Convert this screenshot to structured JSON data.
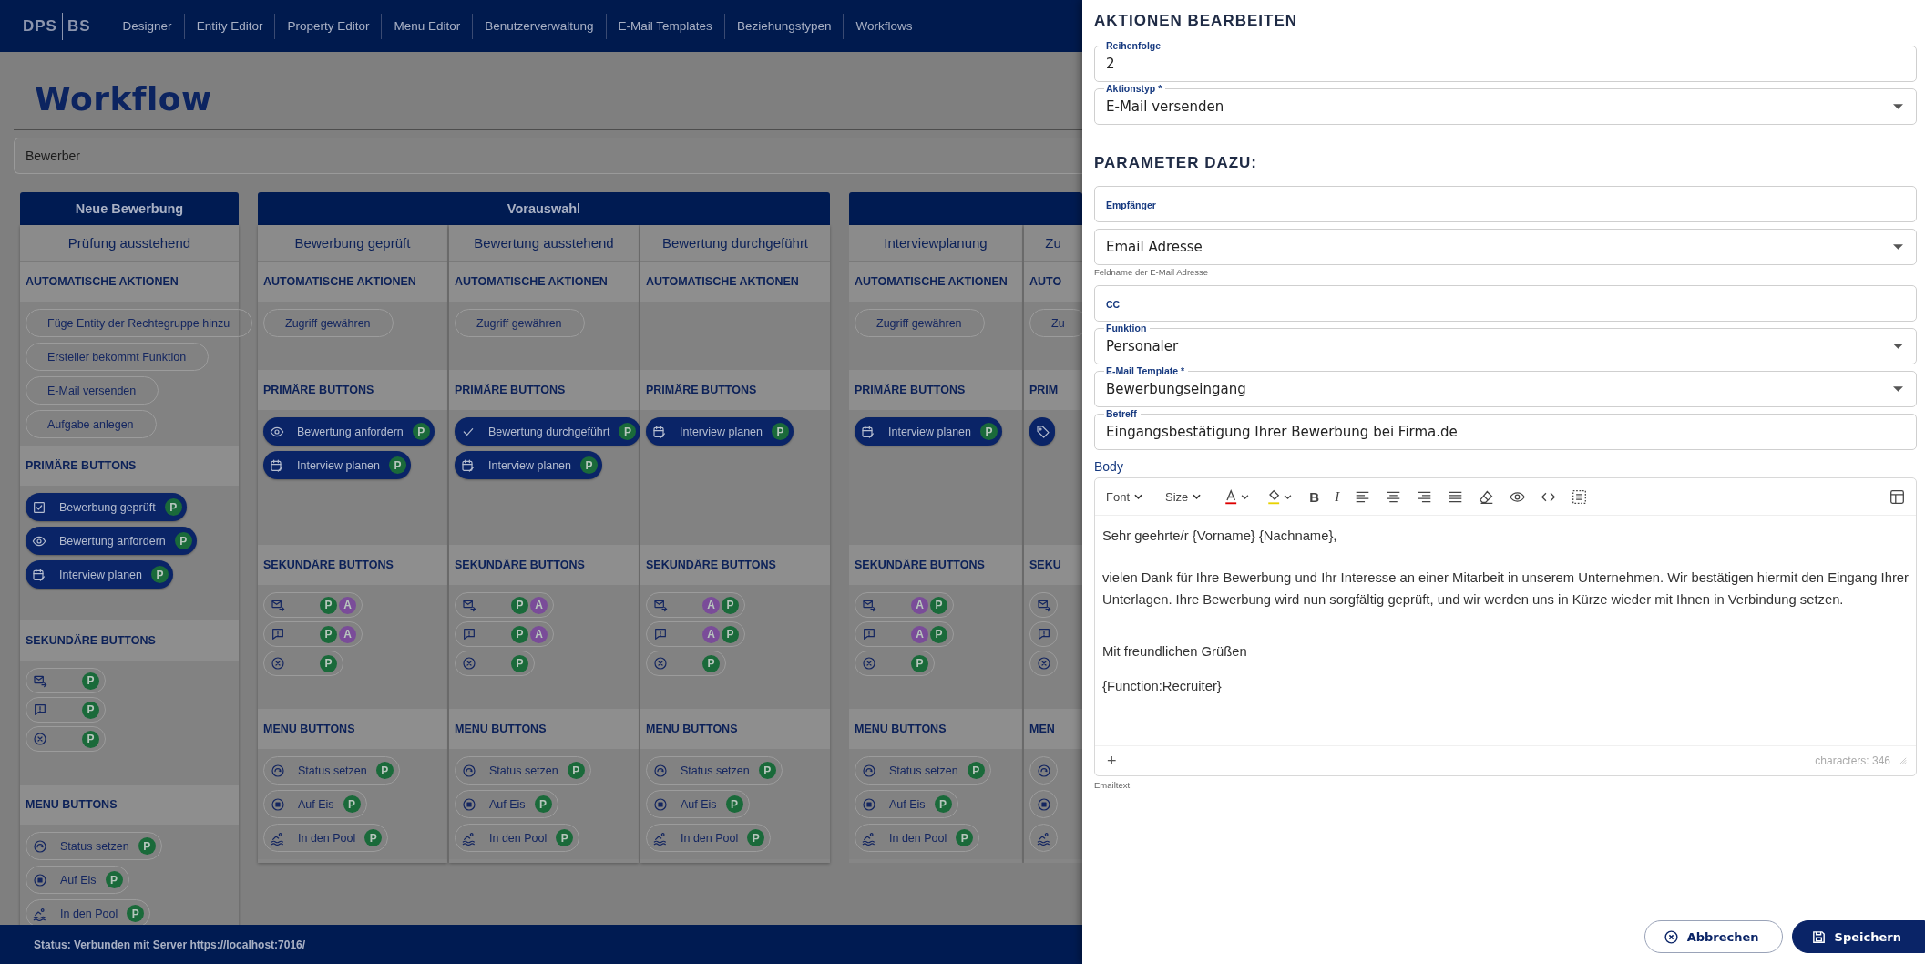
{
  "nav": {
    "logo_left": "DPS",
    "logo_right": "BS",
    "items": [
      "Designer",
      "Entity Editor",
      "Property Editor",
      "Menu Editor",
      "Benutzerverwaltung",
      "E-Mail Templates",
      "Beziehungstypen",
      "Workflows"
    ]
  },
  "page": {
    "title": "Workflow",
    "entity_select": "Bewerber"
  },
  "groups": [
    {
      "title": "Neue Bewerbung",
      "columns": [
        {
          "title": "Prüfung ausstehend",
          "sections": [
            {
              "kind": "auto",
              "title": "AUTOMATISCHE AKTIONEN",
              "items": [
                {
                  "label": "Füge Entity der Rechtegruppe hinzu"
                },
                {
                  "label": "Ersteller bekommt Funktion"
                },
                {
                  "label": "E-Mail versenden"
                },
                {
                  "label": "Aufgabe anlegen"
                }
              ]
            },
            {
              "kind": "primary",
              "title": "PRIMÄRE BUTTONS",
              "items": [
                {
                  "kind": "checkbox",
                  "label": "Bewerbung geprüft",
                  "badges": [
                    {
                      "text": "P",
                      "color": "#1a6a3a"
                    }
                  ]
                },
                {
                  "kind": "eye",
                  "label": "Bewertung anfordern",
                  "badges": [
                    {
                      "text": "P",
                      "color": "#1a6a3a"
                    }
                  ]
                },
                {
                  "kind": "calendar",
                  "label": "Interview planen",
                  "badges": [
                    {
                      "text": "P",
                      "color": "#1a6a3a"
                    }
                  ]
                }
              ]
            },
            {
              "kind": "secondary",
              "title": "SEKUNDÄRE BUTTONS",
              "items": [
                {
                  "kind": "mail",
                  "badges": [
                    {
                      "text": "P",
                      "color": "#1a6a3a"
                    }
                  ]
                },
                {
                  "kind": "comment",
                  "badges": [
                    {
                      "text": "P",
                      "color": "#1a6a3a"
                    }
                  ]
                },
                {
                  "kind": "cancel",
                  "badges": [
                    {
                      "text": "P",
                      "color": "#1a6a3a"
                    }
                  ]
                }
              ]
            },
            {
              "kind": "menu",
              "title": "MENU BUTTONS",
              "items": [
                {
                  "kind": "status",
                  "label": "Status setzen",
                  "badges": [
                    {
                      "text": "P",
                      "color": "#1a6a3a"
                    }
                  ]
                },
                {
                  "kind": "stop",
                  "label": "Auf Eis",
                  "badges": [
                    {
                      "text": "P",
                      "color": "#1a6a3a"
                    }
                  ]
                },
                {
                  "kind": "pool",
                  "label": "In den Pool",
                  "badges": [
                    {
                      "text": "P",
                      "color": "#1a6a3a"
                    }
                  ]
                }
              ]
            }
          ]
        }
      ]
    },
    {
      "title": "Vorauswahl",
      "columns": [
        {
          "title": "Bewerbung geprüft",
          "sections": [
            {
              "kind": "auto",
              "title": "AUTOMATISCHE AKTIONEN",
              "items": [
                {
                  "label": "Zugriff gewähren"
                }
              ]
            },
            {
              "kind": "primary",
              "title": "PRIMÄRE BUTTONS",
              "items": [
                {
                  "kind": "eye",
                  "label": "Bewertung anfordern",
                  "badges": [
                    {
                      "text": "P",
                      "color": "#1a6a3a"
                    }
                  ]
                },
                {
                  "kind": "calendar",
                  "label": "Interview planen",
                  "badges": [
                    {
                      "text": "P",
                      "color": "#1a6a3a"
                    }
                  ]
                }
              ]
            },
            {
              "kind": "secondary",
              "title": "SEKUNDÄRE BUTTONS",
              "items": [
                {
                  "kind": "mail",
                  "badges": [
                    {
                      "text": "P",
                      "color": "#1a6a3a"
                    },
                    {
                      "text": "A",
                      "color": "#7a4c99"
                    }
                  ]
                },
                {
                  "kind": "comment",
                  "badges": [
                    {
                      "text": "P",
                      "color": "#1a6a3a"
                    },
                    {
                      "text": "A",
                      "color": "#7a4c99"
                    }
                  ]
                },
                {
                  "kind": "cancel",
                  "badges": [
                    {
                      "text": "P",
                      "color": "#1a6a3a"
                    }
                  ]
                }
              ]
            },
            {
              "kind": "menu",
              "title": "MENU BUTTONS",
              "items": [
                {
                  "kind": "status",
                  "label": "Status setzen",
                  "badges": [
                    {
                      "text": "P",
                      "color": "#1a6a3a"
                    }
                  ]
                },
                {
                  "kind": "stop",
                  "label": "Auf Eis",
                  "badges": [
                    {
                      "text": "P",
                      "color": "#1a6a3a"
                    }
                  ]
                },
                {
                  "kind": "pool",
                  "label": "In den Pool",
                  "badges": [
                    {
                      "text": "P",
                      "color": "#1a6a3a"
                    }
                  ]
                }
              ]
            }
          ]
        },
        {
          "title": "Bewertung ausstehend",
          "sections": [
            {
              "kind": "auto",
              "title": "AUTOMATISCHE AKTIONEN",
              "items": [
                {
                  "label": "Zugriff gewähren"
                }
              ]
            },
            {
              "kind": "primary",
              "title": "PRIMÄRE BUTTONS",
              "items": [
                {
                  "kind": "check",
                  "label": "Bewertung durchgeführt",
                  "badges": [
                    {
                      "text": "P",
                      "color": "#1a6a3a"
                    }
                  ]
                },
                {
                  "kind": "calendar",
                  "label": "Interview planen",
                  "badges": [
                    {
                      "text": "P",
                      "color": "#1a6a3a"
                    }
                  ]
                }
              ]
            },
            {
              "kind": "secondary",
              "title": "SEKUNDÄRE BUTTONS",
              "items": [
                {
                  "kind": "mail",
                  "badges": [
                    {
                      "text": "P",
                      "color": "#1a6a3a"
                    },
                    {
                      "text": "A",
                      "color": "#7a4c99"
                    }
                  ]
                },
                {
                  "kind": "comment",
                  "badges": [
                    {
                      "text": "P",
                      "color": "#1a6a3a"
                    },
                    {
                      "text": "A",
                      "color": "#7a4c99"
                    }
                  ]
                },
                {
                  "kind": "cancel",
                  "badges": [
                    {
                      "text": "P",
                      "color": "#1a6a3a"
                    }
                  ]
                }
              ]
            },
            {
              "kind": "menu",
              "title": "MENU BUTTONS",
              "items": [
                {
                  "kind": "status",
                  "label": "Status setzen",
                  "badges": [
                    {
                      "text": "P",
                      "color": "#1a6a3a"
                    }
                  ]
                },
                {
                  "kind": "stop",
                  "label": "Auf Eis",
                  "badges": [
                    {
                      "text": "P",
                      "color": "#1a6a3a"
                    }
                  ]
                },
                {
                  "kind": "pool",
                  "label": "In den Pool",
                  "badges": [
                    {
                      "text": "P",
                      "color": "#1a6a3a"
                    }
                  ]
                }
              ]
            }
          ]
        },
        {
          "title": "Bewertung durchgeführt",
          "sections": [
            {
              "kind": "auto",
              "title": "AUTOMATISCHE AKTIONEN"
            },
            {
              "kind": "primary",
              "title": "PRIMÄRE BUTTONS",
              "items": [
                {
                  "kind": "calendar",
                  "label": "Interview planen",
                  "badges": [
                    {
                      "text": "P",
                      "color": "#1a6a3a"
                    }
                  ]
                }
              ]
            },
            {
              "kind": "secondary",
              "title": "SEKUNDÄRE BUTTONS",
              "items": [
                {
                  "kind": "mail",
                  "badges": [
                    {
                      "text": "A",
                      "color": "#7a4c99"
                    },
                    {
                      "text": "P",
                      "color": "#1a6a3a"
                    }
                  ]
                },
                {
                  "kind": "comment",
                  "badges": [
                    {
                      "text": "A",
                      "color": "#7a4c99"
                    },
                    {
                      "text": "P",
                      "color": "#1a6a3a"
                    }
                  ]
                },
                {
                  "kind": "cancel",
                  "badges": [
                    {
                      "text": "P",
                      "color": "#1a6a3a"
                    }
                  ]
                }
              ]
            },
            {
              "kind": "menu",
              "title": "MENU BUTTONS",
              "items": [
                {
                  "kind": "status",
                  "label": "Status setzen",
                  "badges": [
                    {
                      "text": "P",
                      "color": "#1a6a3a"
                    }
                  ]
                },
                {
                  "kind": "stop",
                  "label": "Auf Eis",
                  "badges": [
                    {
                      "text": "P",
                      "color": "#1a6a3a"
                    }
                  ]
                },
                {
                  "kind": "pool",
                  "label": "In den Pool",
                  "badges": [
                    {
                      "text": "P",
                      "color": "#1a6a3a"
                    }
                  ]
                }
              ]
            }
          ]
        }
      ]
    },
    {
      "columns": [
        {
          "title": "Interviewplanung",
          "sections": [
            {
              "kind": "auto",
              "title": "AUTOMATISCHE AKTIONEN",
              "items": [
                {
                  "label": "Zugriff gewähren"
                }
              ]
            },
            {
              "kind": "primary",
              "title": "PRIMÄRE BUTTONS",
              "items": [
                {
                  "kind": "calendar",
                  "label": "Interview planen",
                  "badges": [
                    {
                      "text": "P",
                      "color": "#1a6a3a"
                    }
                  ]
                }
              ]
            },
            {
              "kind": "secondary",
              "title": "SEKUNDÄRE BUTTONS",
              "items": [
                {
                  "kind": "mail",
                  "badges": [
                    {
                      "text": "A",
                      "color": "#7a4c99"
                    },
                    {
                      "text": "P",
                      "color": "#1a6a3a"
                    }
                  ]
                },
                {
                  "kind": "comment",
                  "badges": [
                    {
                      "text": "A",
                      "color": "#7a4c99"
                    },
                    {
                      "text": "P",
                      "color": "#1a6a3a"
                    }
                  ]
                },
                {
                  "kind": "cancel",
                  "badges": [
                    {
                      "text": "P",
                      "color": "#1a6a3a"
                    }
                  ]
                }
              ]
            },
            {
              "kind": "menu",
              "title": "MENU BUTTONS",
              "items": [
                {
                  "kind": "status",
                  "label": "Status setzen",
                  "badges": [
                    {
                      "text": "P",
                      "color": "#1a6a3a"
                    }
                  ]
                },
                {
                  "kind": "stop",
                  "label": "Auf Eis",
                  "badges": [
                    {
                      "text": "P",
                      "color": "#1a6a3a"
                    }
                  ]
                },
                {
                  "kind": "pool",
                  "label": "In den Pool",
                  "badges": [
                    {
                      "text": "P",
                      "color": "#1a6a3a"
                    }
                  ]
                }
              ]
            }
          ]
        },
        {
          "title": "Zu",
          "sections": [
            {
              "kind": "auto",
              "title": "AUTO",
              "items": [
                {
                  "label": "Zu"
                }
              ]
            },
            {
              "kind": "primary",
              "title": "PRIM",
              "items": [
                {
                  "kind": "tag"
                }
              ]
            },
            {
              "kind": "secondary",
              "title": "SEKU",
              "items": [
                {
                  "kind": "mail"
                },
                {
                  "kind": "comment"
                },
                {
                  "kind": "cancel"
                }
              ]
            },
            {
              "kind": "menu",
              "title": "MEN",
              "items": [
                {
                  "kind": "status"
                },
                {
                  "kind": "stop"
                },
                {
                  "kind": "pool"
                }
              ]
            }
          ]
        }
      ]
    }
  ],
  "status_bar": "Status: Verbunden mit Server https://localhost:7016/",
  "drawer": {
    "title": "AKTIONEN BEARBEITEN",
    "fields": [
      {
        "kind": "input",
        "label": "Reihenfolge",
        "value": "2"
      },
      {
        "kind": "select",
        "label": "Aktionstyp *",
        "value": "E-Mail versenden"
      }
    ],
    "section_title": "PARAMETER DAZU:",
    "params": [
      {
        "kind": "input",
        "placeholder": "Empfänger"
      },
      {
        "kind": "select",
        "value": "Email Adresse",
        "hint": "Feldname der E-Mail Adresse"
      },
      {
        "kind": "input",
        "placeholder": "CC"
      },
      {
        "kind": "select",
        "label": "Funktion",
        "value": "Personaler"
      },
      {
        "kind": "select",
        "label": "E-Mail Template *",
        "value": "Bewerbungseingang"
      },
      {
        "kind": "input",
        "label": "Betreff",
        "value": "Eingangsbestätigung Ihrer Bewerbung bei Firma.de"
      }
    ],
    "body": {
      "label": "Body",
      "toolbar": {
        "font": "Font",
        "size": "Size",
        "bold": "B",
        "italic": "I"
      },
      "paragraphs": [
        "Sehr geehrte/r {Vorname} {Nachname},",
        "vielen Dank für Ihre Bewerbung und Ihr Interesse an einer Mitarbeit in unserem Unternehmen. Wir bestätigen hiermit den Eingang Ihrer Unterlagen. Ihre Bewerbung wird nun sorgfältig geprüft, und wir werden uns in Kürze wieder mit Ihnen in Verbindung setzen.",
        "Mit freundlichen Grüßen",
        "{Function:Recruiter}"
      ],
      "add": "+",
      "counter": "characters: 346",
      "hint": "Emailtext"
    },
    "buttons": [
      {
        "kind": "secondary",
        "label": "Abbrechen"
      },
      {
        "kind": "primary",
        "label": "Speichern"
      }
    ]
  }
}
